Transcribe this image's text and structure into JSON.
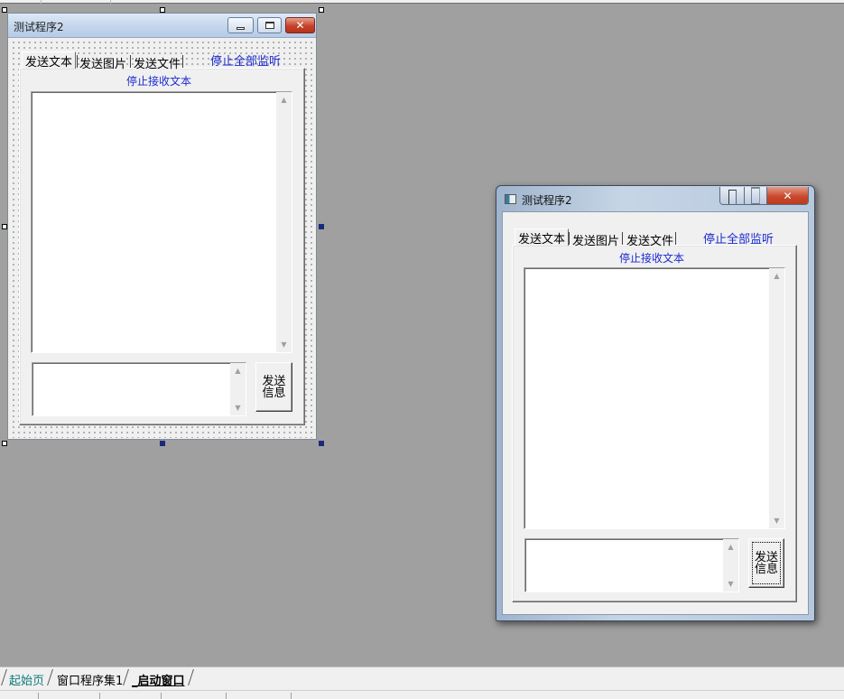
{
  "designer": {
    "title": "测试程序2",
    "tabs": [
      "发送文本",
      "发送图片",
      "发送文件"
    ],
    "stop_all_label": "停止全部监听",
    "stop_receive_label": "停止接收文本",
    "send_button_label": "发送\n信息"
  },
  "running_window": {
    "title": "测试程序2",
    "tabs": [
      "发送文本",
      "发送图片",
      "发送文件"
    ],
    "stop_all_label": "停止全部监听",
    "stop_receive_label": "停止接收文本",
    "send_button_label": "发送\n信息"
  },
  "bottom_tabs": [
    "起始页",
    "窗口程序集1",
    "_启动窗口"
  ],
  "colors": {
    "workspace": "#a0a0a0",
    "link": "#1a2ad0",
    "active_tab": "#0f7a7a"
  },
  "icons": {
    "minimize": "minimize-icon",
    "maximize": "maximize-icon",
    "close": "close-icon",
    "scroll_up": "scroll-up-icon",
    "scroll_down": "scroll-down-icon"
  }
}
